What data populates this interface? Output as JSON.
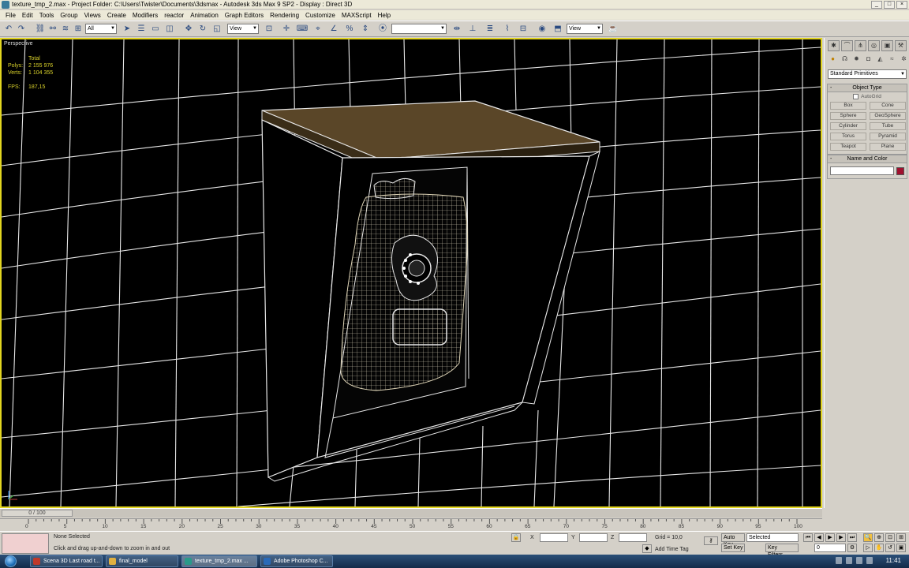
{
  "window": {
    "title": "texture_tmp_2.max     - Project Folder: C:\\Users\\Twister\\Documents\\3dsmax     - Autodesk 3ds Max 9 SP2     - Display : Direct 3D",
    "controls": [
      "_",
      "□",
      "×"
    ]
  },
  "menu": [
    "File",
    "Edit",
    "Tools",
    "Group",
    "Views",
    "Create",
    "Modifiers",
    "reactor",
    "Animation",
    "Graph Editors",
    "Rendering",
    "Customize",
    "MAXScript",
    "Help"
  ],
  "toolbar": {
    "selection_filter": "All",
    "ref_coord": "View",
    "named_selection": "",
    "view_dropdown": "View"
  },
  "viewport": {
    "label": "Perspective",
    "stats": {
      "total_label": "Total",
      "polys_label": "Polys:",
      "polys_value": "2 155 976",
      "verts_label": "Verts:",
      "verts_value": "1 104 355",
      "fps_label": "FPS:",
      "fps_value": "187,15"
    },
    "colors": {
      "border": "#e2d520",
      "wire": "#ffffff",
      "roof": "#5a4628",
      "stats": "#d9d12a"
    }
  },
  "command_panel": {
    "dropdown": "Standard Primitives",
    "object_type": {
      "title": "Object Type",
      "autogrid": "AutoGrid",
      "buttons": [
        "Box",
        "Cone",
        "Sphere",
        "GeoSphere",
        "Cylinder",
        "Tube",
        "Torus",
        "Pyramid",
        "Teapot",
        "Plane"
      ]
    },
    "name_and_color": {
      "title": "Name and Color",
      "name_value": "",
      "color": "#a0102e"
    }
  },
  "time_slider": {
    "frame": "0 / 100",
    "ticks": [
      "0",
      "5",
      "10",
      "15",
      "20",
      "25",
      "30",
      "35",
      "40",
      "45",
      "50",
      "55",
      "60",
      "65",
      "70",
      "75",
      "80",
      "85",
      "90",
      "95",
      "100"
    ]
  },
  "status": {
    "selection": "None Selected",
    "prompt": "Click and drag up-and-down to zoom in and out",
    "x_label": "X",
    "y_label": "Y",
    "z_label": "Z",
    "grid": "Grid = 10,0",
    "add_time_tag": "Add Time Tag",
    "auto_key": "Auto Key",
    "set_key": "Set Key",
    "selected": "Selected",
    "key_filters": "Key Filters...",
    "frame_field": "0"
  },
  "taskbar": {
    "items": [
      {
        "label": "Scena 3D Last road t...",
        "color": "#c0392b"
      },
      {
        "label": "final_model",
        "color": "#e0b040"
      },
      {
        "label": "texture_tmp_2.max ...",
        "color": "#2a9a8a"
      },
      {
        "label": "Adobe Photoshop C...",
        "color": "#2a6ab8"
      }
    ],
    "clock": "11:41"
  }
}
